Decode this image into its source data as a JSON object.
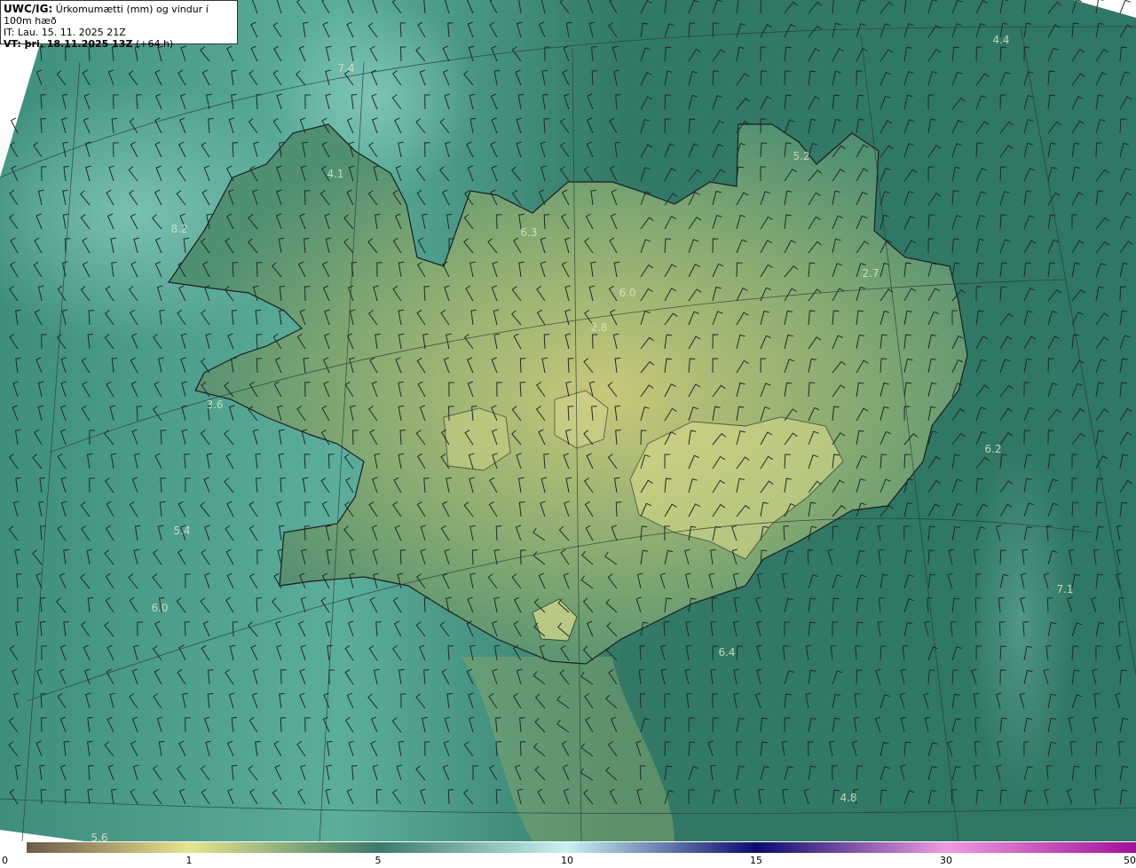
{
  "header": {
    "title_code": "UWC/IG:",
    "title_text": "Úrkomumætti (mm) og vindur í 100m hæð",
    "it_line": "IT: Lau. 15. 11. 2025 21Z",
    "vt_label": "VT: þri. 18.11.2025 13Z",
    "vt_offset": "(+64 h)"
  },
  "map": {
    "labels": [
      {
        "name": "label-4-4",
        "text": "4.4"
      },
      {
        "name": "label-7-4",
        "text": "7.4"
      },
      {
        "name": "label-5-2",
        "text": "5.2"
      },
      {
        "name": "label-4-1",
        "text": "4.1"
      },
      {
        "name": "label-6-3",
        "text": "6.3"
      },
      {
        "name": "label-8-2",
        "text": "8.2"
      },
      {
        "name": "label-2-7",
        "text": "2.7"
      },
      {
        "name": "label-6-0-north",
        "text": "6.0"
      },
      {
        "name": "label-2-8",
        "text": "2.8"
      },
      {
        "name": "label-3-6",
        "text": "3.6"
      },
      {
        "name": "label-6-2",
        "text": "6.2"
      },
      {
        "name": "label-5-4",
        "text": "5.4"
      },
      {
        "name": "label-6-0-west",
        "text": "6.0"
      },
      {
        "name": "label-7-1",
        "text": "7.1"
      },
      {
        "name": "label-6-4",
        "text": "6.4"
      },
      {
        "name": "label-4-8",
        "text": "4.8"
      },
      {
        "name": "label-5-6",
        "text": "5.6"
      }
    ]
  },
  "colorbar": {
    "stops": [
      {
        "value": 0,
        "color": "#6b5a4a"
      },
      {
        "value": 1,
        "color": "#e6e48e"
      },
      {
        "value": 5,
        "color": "#3a7a6a"
      },
      {
        "value": 10,
        "color": "#c9f2f2"
      },
      {
        "value": 15,
        "color": "#0b0b6e"
      },
      {
        "value": 30,
        "color": "#f09ae0"
      },
      {
        "value": 50,
        "color": "#a0109a"
      }
    ],
    "ticks": [
      "0",
      "1",
      "5",
      "10",
      "15",
      "30",
      "50"
    ]
  }
}
